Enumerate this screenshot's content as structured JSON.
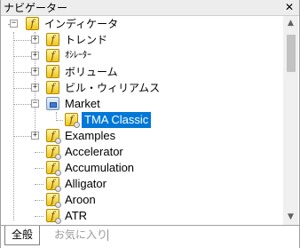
{
  "window": {
    "title": "ナビゲーター",
    "close_glyph": "✕"
  },
  "tree": {
    "root": {
      "label": "インディケータ",
      "expander": "−"
    },
    "groups": [
      {
        "label": "トレンド",
        "expander": "+"
      },
      {
        "label": "ｵｼﾚｰﾀｰ",
        "expander": "+"
      },
      {
        "label": "ボリューム",
        "expander": "+"
      },
      {
        "label": "ビル・ウィリアムス",
        "expander": "+"
      }
    ],
    "market": {
      "label": "Market",
      "expander": "−",
      "child": "TMA Classic"
    },
    "examples": {
      "label": "Examples",
      "expander": "+"
    },
    "indicators": [
      "Accelerator",
      "Accumulation",
      "Alligator",
      "Aroon",
      "ATR"
    ],
    "icon_glyph": "f"
  },
  "scrollbar": {
    "up_glyph": "▲",
    "down_glyph": "▼"
  },
  "tabs": {
    "general": "全般",
    "favorites": "お気に入り"
  }
}
